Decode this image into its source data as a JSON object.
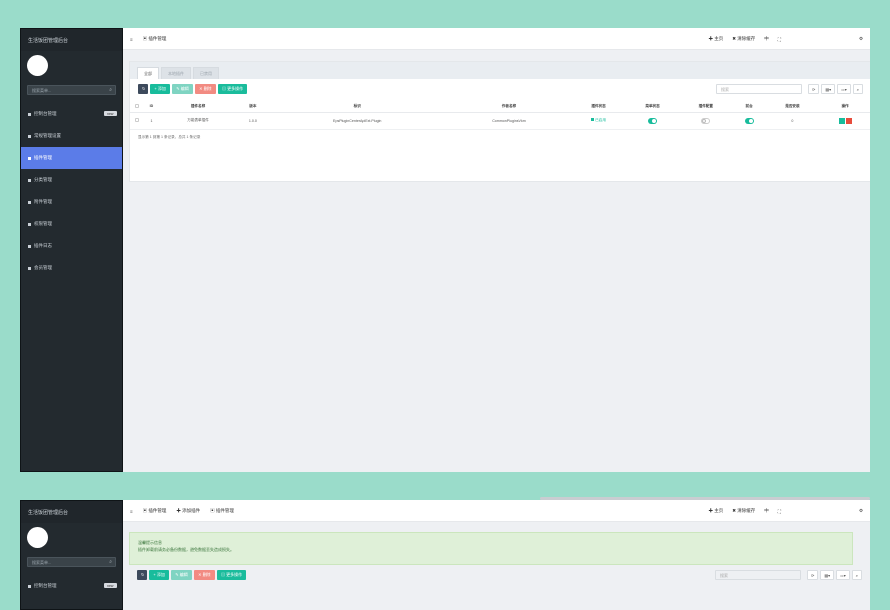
{
  "brand": "生活饭团管理后台",
  "sidebar": {
    "search_placeholder": "搜索菜单...",
    "items": [
      {
        "label": "控制台管理",
        "badge": "new"
      },
      {
        "label": "常规管理设置"
      },
      {
        "label": "插件管理"
      },
      {
        "label": "分类管理"
      },
      {
        "label": "附件管理"
      },
      {
        "label": "权限管理"
      },
      {
        "label": "插件日志"
      },
      {
        "label": "会员管理"
      }
    ]
  },
  "topbar": {
    "breadcrumb": "插件管理",
    "breadcrumb2": [
      "插件管理",
      "添加插件",
      "插件管理"
    ],
    "right": [
      "主页",
      "清除缓存",
      "中",
      "全屏"
    ]
  },
  "tabs": [
    "全部",
    "本地插件",
    "已禁用"
  ],
  "toolbar": {
    "buttons": [
      "添加",
      "编辑",
      "删除",
      "更多操作"
    ],
    "search_placeholder": "搜索",
    "tools": [
      "刷",
      "导出",
      "列",
      "搜"
    ]
  },
  "table": {
    "headers": [
      "",
      "ID",
      "插件名称",
      "版本",
      "标识",
      "作者名称",
      "插件状态",
      "菜单状态",
      "插件配置",
      "前台",
      "是否安装",
      "操作"
    ],
    "rows": [
      {
        "id": "1",
        "name": "万能表单插件",
        "version": "1.0.0",
        "ident": "EpsPluginCenterApiExt.Plugin",
        "author": "CommonPluginsVkm",
        "status": "已启用"
      }
    ]
  },
  "pager": "显示第 1 到第 1 条记录，总共 1 条记录",
  "alert": {
    "title": "温馨提示信息",
    "body": "插件卸载前请务必备份数据，避免数据丢失造成损失。"
  }
}
